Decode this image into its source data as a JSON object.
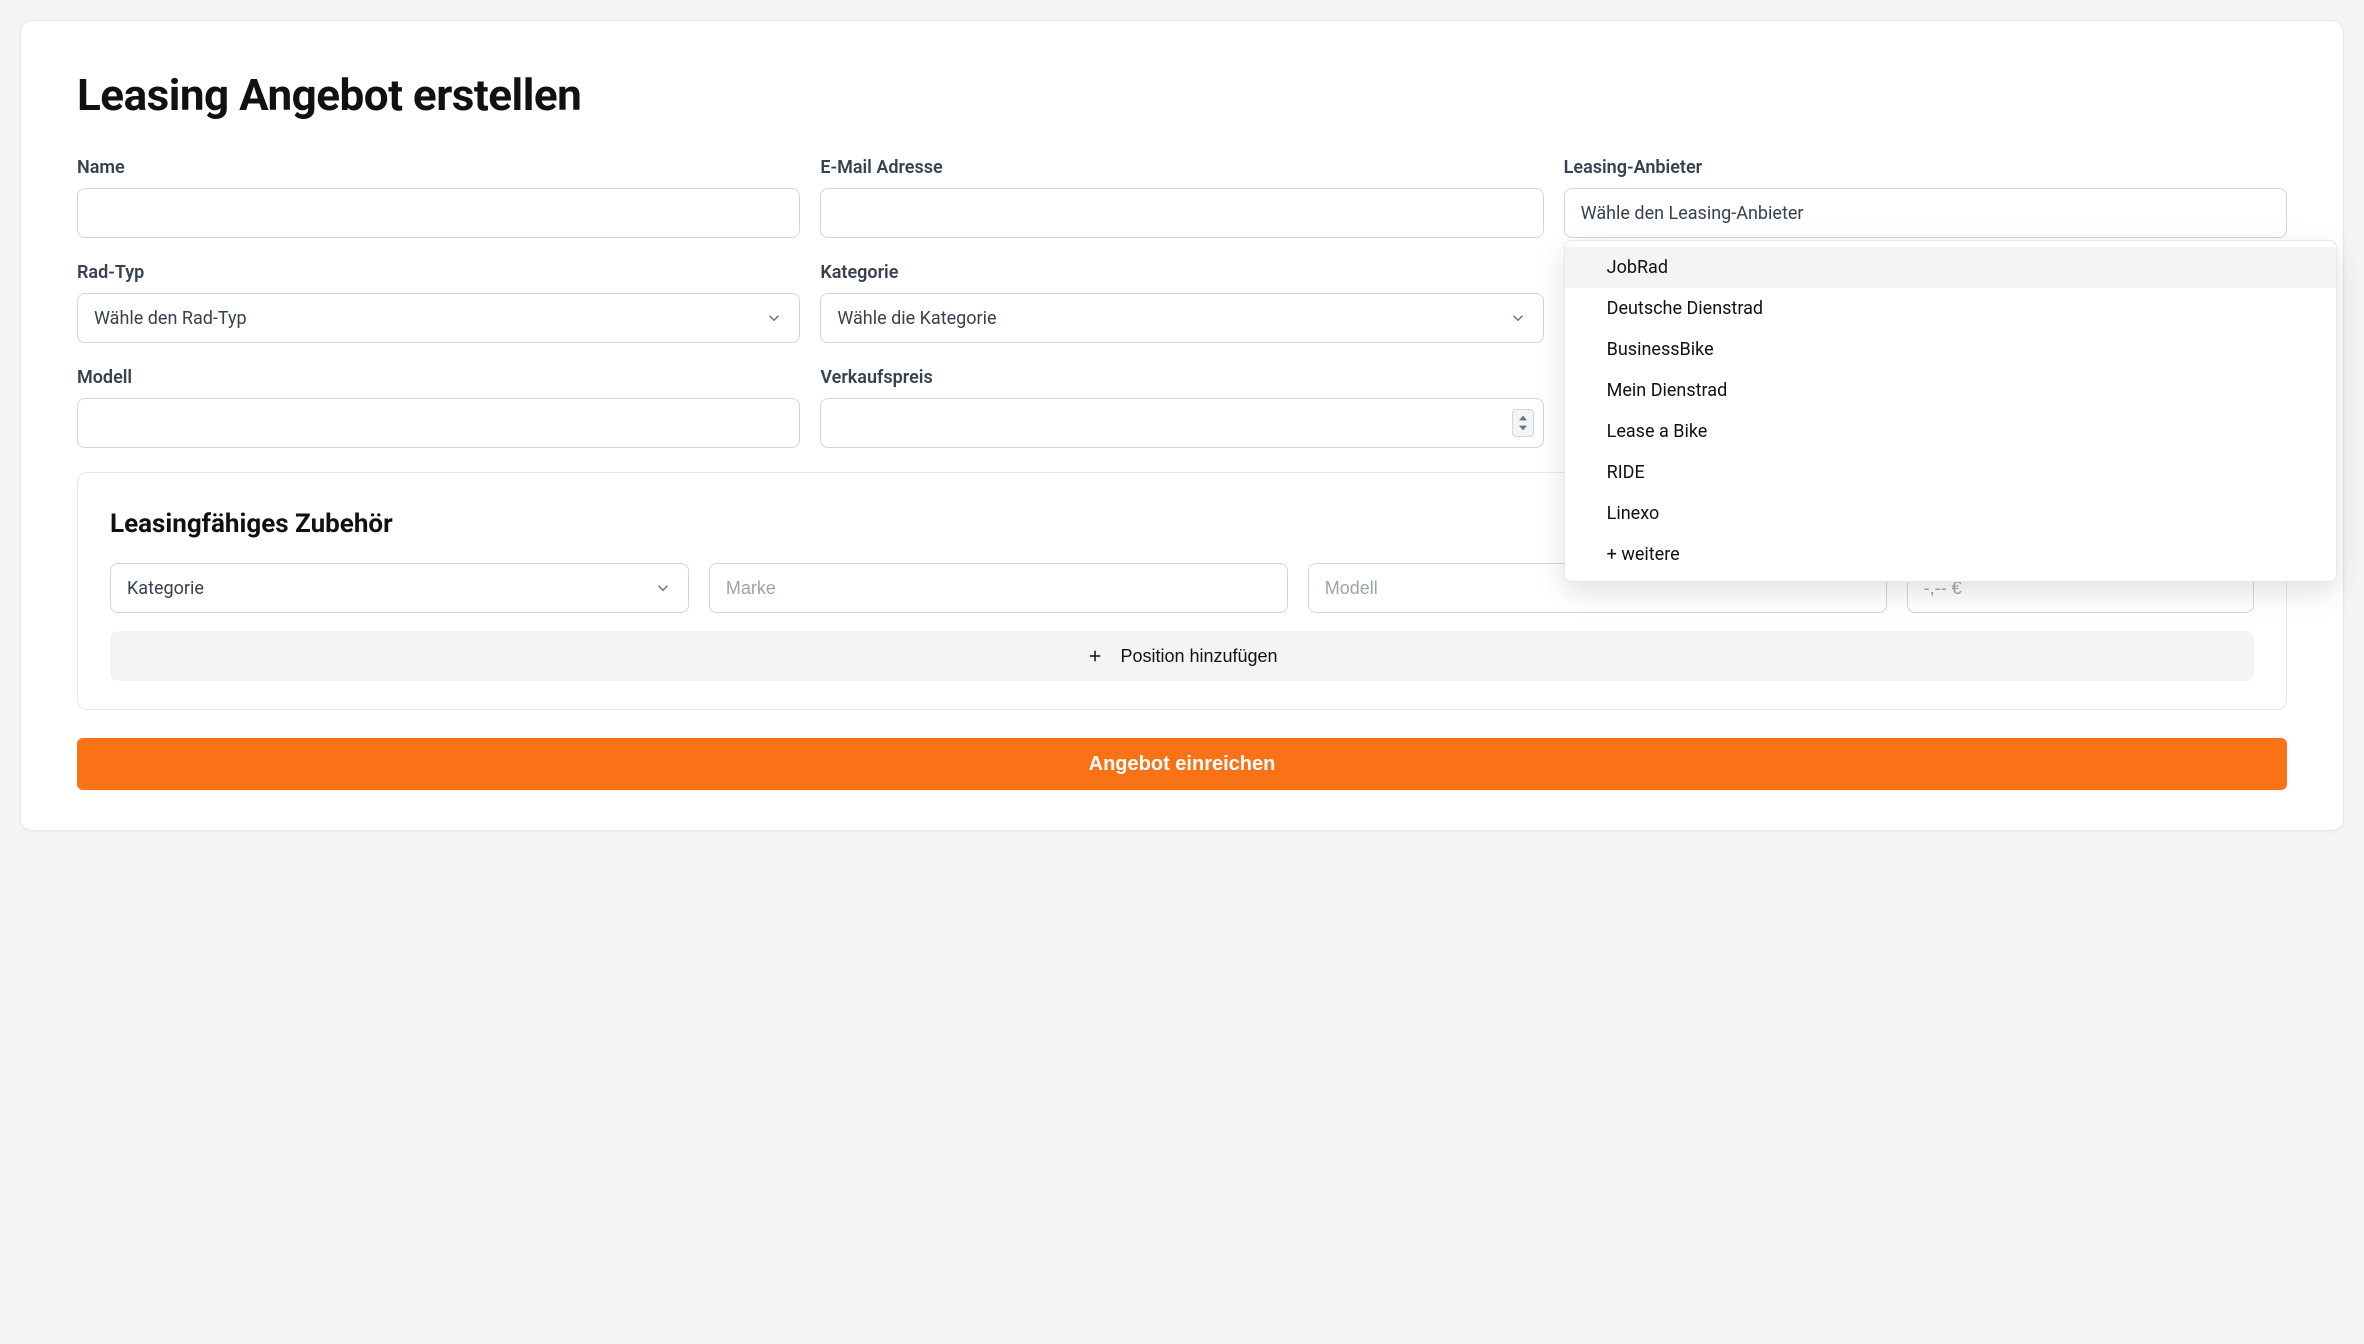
{
  "page_title": "Leasing Angebot erstellen",
  "fields": {
    "name": {
      "label": "Name",
      "value": ""
    },
    "email": {
      "label": "E-Mail Adresse",
      "value": ""
    },
    "provider": {
      "label": "Leasing-Anbieter",
      "placeholder": "Wähle den Leasing-Anbieter",
      "options": [
        "JobRad",
        "Deutsche Dienstrad",
        "BusinessBike",
        "Mein Dienstrad",
        "Lease a Bike",
        "RIDE",
        "Linexo",
        "+ weitere"
      ]
    },
    "bike_type": {
      "label": "Rad-Typ",
      "placeholder": "Wähle den Rad-Typ"
    },
    "category": {
      "label": "Kategorie",
      "placeholder": "Wähle die Kategorie"
    },
    "model": {
      "label": "Modell",
      "value": ""
    },
    "price": {
      "label": "Verkaufspreis",
      "value": ""
    }
  },
  "accessories": {
    "title": "Leasingfähiges Zubehör",
    "row": {
      "category_placeholder": "Kategorie",
      "brand_placeholder": "Marke",
      "model_placeholder": "Modell",
      "price_placeholder": "-,-- €"
    },
    "add_button": "Position hinzufügen"
  },
  "submit_button": "Angebot einreichen"
}
